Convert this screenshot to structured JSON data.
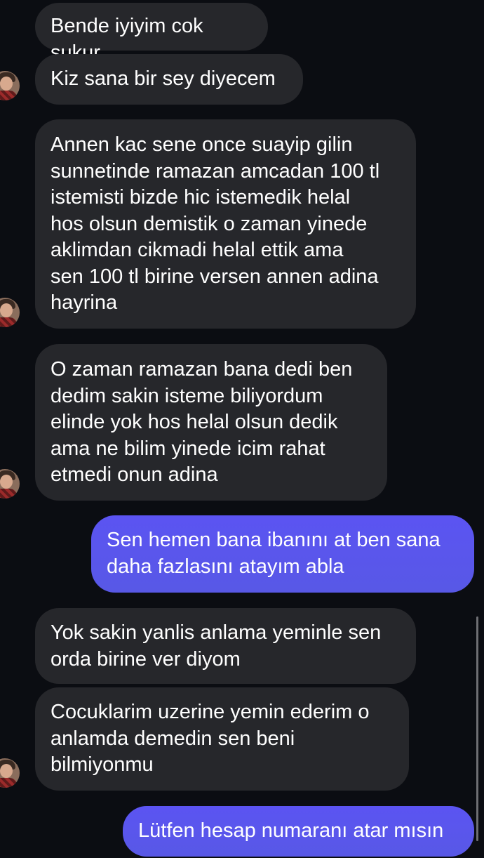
{
  "messages": [
    {
      "text": "Bende iyiyim cok sukur"
    },
    {
      "text": "Kiz sana bir sey diyecem"
    },
    {
      "text": "Annen kac sene once suayip gilin\nsunnetinde ramazan amcadan 100 tl\nistemisti bizde hic istemedik helal\nhos olsun demistik o zaman yinede\naklimdan cikmadi helal ettik ama\nsen 100 tl birine versen annen adina\nhayrina"
    },
    {
      "text": "O zaman ramazan bana dedi ben\ndedim sakin isteme biliyordum\nelinde yok hos helal olsun dedik\nama ne bilim yinede icim rahat\netmedi onun adina"
    },
    {
      "text": "Sen hemen bana ibanını at ben sana\ndaha fazlasını atayım abla"
    },
    {
      "text": "Yok sakin yanlis anlama yeminle sen\norda birine ver diyom"
    },
    {
      "text": "Cocuklarim uzerine yemin ederim o\nanlamda demedin sen beni\nbilmiyonmu"
    },
    {
      "text": "Lütfen hesap numaranı atar mısın"
    }
  ],
  "colors": {
    "background": "#0b0d12",
    "incoming_bubble": "#26272b",
    "outgoing_bubble": "#5858e6",
    "text": "#ffffff"
  }
}
